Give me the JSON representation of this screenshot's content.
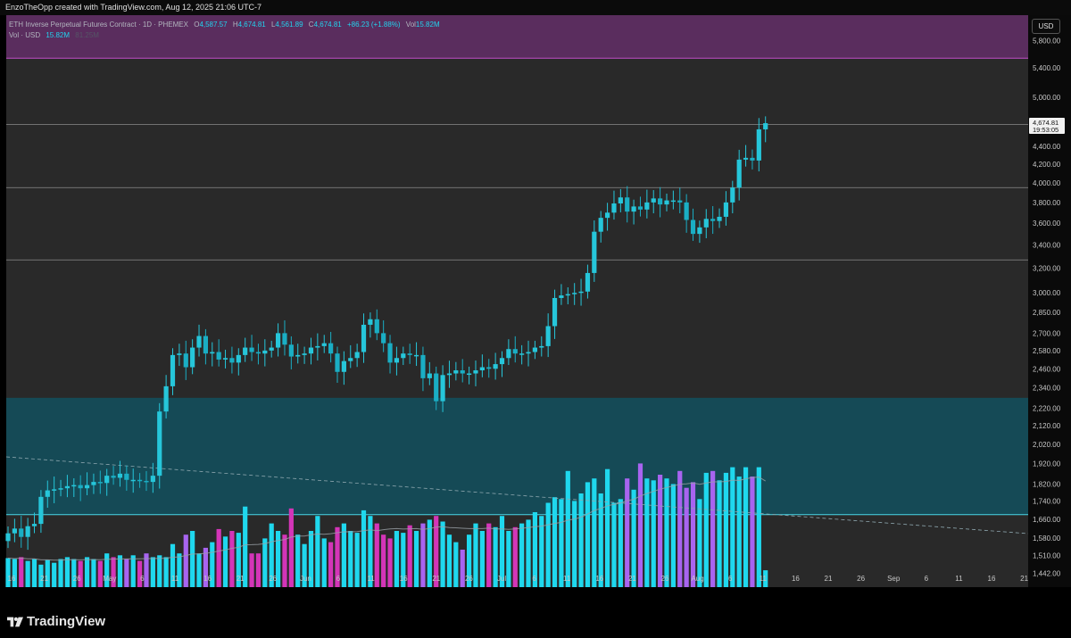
{
  "header": {
    "attribution": "EnzoTheOpp created with TradingView.com, Aug 12, 2025 21:06 UTC-7"
  },
  "legend": {
    "symbol": "ETH Inverse Perpetual Futures Contract · 1D · PHEMEX",
    "open_label": "O",
    "open": "4,587.57",
    "high_label": "H",
    "high": "4,674.81",
    "low_label": "L",
    "low": "4,561.89",
    "close_label": "C",
    "close": "4,674.81",
    "change": "+86.23 (+1.88%)",
    "vol_label": "Vol",
    "vol": "15.82M",
    "volume_row_label": "Vol · USD",
    "volume_value": "15.82M",
    "volume_ma": "81.25M"
  },
  "price_scale": {
    "currency_badge": "USD",
    "last_price": "4,674.81",
    "countdown": "19:53:05"
  },
  "brand": {
    "name": "TradingView"
  },
  "colors": {
    "background": "#292929",
    "bull": "#26c6da",
    "volume_up": "#1fd8ee",
    "volume_down": "#d435b8",
    "volume_down_alt": "#a864f0",
    "purple_zone": "#5a2d5e",
    "teal_zone": "#154a56"
  },
  "chart_data": {
    "type": "candlestick",
    "title": "ETH Inverse Perpetual Futures Contract · 1D · PHEMEX",
    "ylabel": "USD",
    "y_scale": "log",
    "ylim": [
      1390,
      6200
    ],
    "x_tick_labels": [
      "16",
      "21",
      "26",
      "May",
      "6",
      "11",
      "16",
      "21",
      "26",
      "Jun",
      "6",
      "11",
      "16",
      "21",
      "26",
      "Jul",
      "6",
      "11",
      "16",
      "21",
      "26",
      "Aug",
      "6",
      "11",
      "16",
      "21",
      "26",
      "Sep",
      "6",
      "11",
      "16",
      "21"
    ],
    "y_tick_labels": [
      "5,800.00",
      "5,400.00",
      "5,000.00",
      "4,400.00",
      "4,200.00",
      "4,000.00",
      "3,800.00",
      "3,600.00",
      "3,400.00",
      "3,200.00",
      "3,000.00",
      "2,850.00",
      "2,700.00",
      "2,580.00",
      "2,460.00",
      "2,340.00",
      "2,220.00",
      "2,120.00",
      "2,020.00",
      "1,920.00",
      "1,820.00",
      "1,740.00",
      "1,660.00",
      "1,580.00",
      "1,510.00",
      "1,442.00"
    ],
    "y_tick_values": [
      5800,
      5400,
      5000,
      4400,
      4200,
      4000,
      3800,
      3600,
      3400,
      3200,
      3000,
      2850,
      2700,
      2580,
      2460,
      2340,
      2220,
      2120,
      2020,
      1920,
      1820,
      1740,
      1660,
      1580,
      1510,
      1442
    ],
    "zones": [
      {
        "name": "supply zone",
        "top": 6300,
        "bottom": 5540
      },
      {
        "name": "demand zone",
        "top": 2280,
        "bottom": 1680
      }
    ],
    "horizontal_levels": [
      4660,
      3950,
      3270
    ],
    "close_series": [
      1600,
      1620,
      1585,
      1630,
      1640,
      1760,
      1790,
      1795,
      1800,
      1810,
      1815,
      1800,
      1815,
      1830,
      1825,
      1860,
      1850,
      1870,
      1840,
      1840,
      1835,
      1830,
      1860,
      2200,
      2350,
      2550,
      2560,
      2470,
      2600,
      2680,
      2560,
      2570,
      2520,
      2530,
      2500,
      2550,
      2600,
      2570,
      2560,
      2580,
      2600,
      2700,
      2620,
      2540,
      2550,
      2560,
      2600,
      2610,
      2630,
      2560,
      2440,
      2510,
      2530,
      2570,
      2760,
      2800,
      2700,
      2630,
      2500,
      2530,
      2560,
      2550,
      2550,
      2400,
      2430,
      2260,
      2420,
      2430,
      2450,
      2430,
      2430,
      2450,
      2470,
      2460,
      2490,
      2530,
      2590,
      2560,
      2560,
      2570,
      2600,
      2610,
      2750,
      2960,
      2980,
      2990,
      3000,
      3010,
      3160,
      3520,
      3650,
      3700,
      3790,
      3850,
      3710,
      3760,
      3730,
      3800,
      3840,
      3780,
      3820,
      3820,
      3800,
      3630,
      3500,
      3560,
      3640,
      3620,
      3660,
      3800,
      3950,
      4250,
      4270,
      4240,
      4600,
      4674.81
    ],
    "volume_series": [
      1.55,
      1.5,
      1.6,
      1.4,
      1.5,
      1.2,
      1.45,
      1.3,
      1.5,
      1.6,
      1.5,
      1.4,
      1.6,
      1.5,
      1.4,
      1.8,
      1.6,
      1.7,
      1.5,
      1.7,
      1.4,
      1.8,
      1.6,
      1.7,
      1.6,
      2.3,
      1.8,
      2.8,
      3.0,
      1.8,
      2.1,
      2.4,
      3.1,
      2.7,
      3.0,
      2.9,
      4.3,
      1.8,
      1.8,
      2.6,
      3.4,
      3.0,
      2.8,
      4.2,
      2.8,
      2.3,
      3.0,
      3.8,
      2.6,
      2.4,
      3.2,
      3.4,
      3.0,
      2.9,
      4.1,
      3.8,
      3.4,
      2.8,
      2.6,
      3.0,
      2.9,
      3.3,
      3.0,
      3.4,
      3.6,
      3.8,
      3.5,
      2.8,
      2.4,
      2.0,
      2.8,
      3.4,
      3.0,
      3.4,
      3.2,
      3.8,
      3.0,
      3.2,
      3.4,
      3.6,
      4.0,
      3.8,
      4.5,
      4.8,
      4.7,
      6.2,
      4.6,
      5.0,
      5.6,
      5.8,
      5.0,
      6.3,
      4.5,
      4.7,
      5.8,
      5.2,
      6.6,
      5.8,
      5.7,
      6.0,
      5.8,
      5.5,
      6.2,
      5.3,
      5.6,
      4.7,
      6.1,
      6.2,
      5.7,
      6.1,
      6.4,
      5.9,
      6.4,
      5.9,
      6.4,
      0.9
    ]
  }
}
